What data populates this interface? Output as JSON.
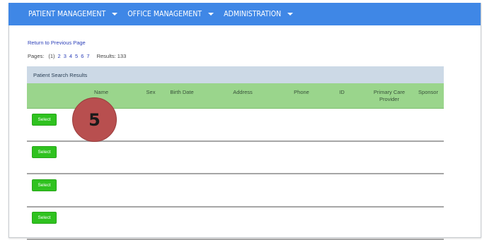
{
  "nav": {
    "items": [
      {
        "label": "PATIENT MANAGEMENT"
      },
      {
        "label": "OFFICE MANAGEMENT"
      },
      {
        "label": "ADMINISTRATION"
      }
    ]
  },
  "return_link": "Return to Previous Page",
  "pagination": {
    "label": "Pages:",
    "current": "(1)",
    "pages": [
      "2",
      "3",
      "4",
      "5",
      "6",
      "7"
    ],
    "results_label": "Results: 133"
  },
  "results": {
    "title": "Patient Search Results",
    "columns": [
      "Name",
      "Sex",
      "Birth Date",
      "Address",
      "Phone",
      "ID",
      "Primary Care Provider",
      "Sponsor"
    ],
    "rows": [
      {
        "select_label": "Select"
      },
      {
        "select_label": "Select"
      },
      {
        "select_label": "Select"
      },
      {
        "select_label": "Select"
      }
    ]
  },
  "annotation": {
    "step_number": "5",
    "color": "#b84f4f"
  },
  "colors": {
    "nav_bg": "#3f87e6",
    "header_bg": "#ccd9e6",
    "columns_bg": "#9ad58c",
    "select_bg": "#2fc21f",
    "link": "#2b3fb8"
  }
}
